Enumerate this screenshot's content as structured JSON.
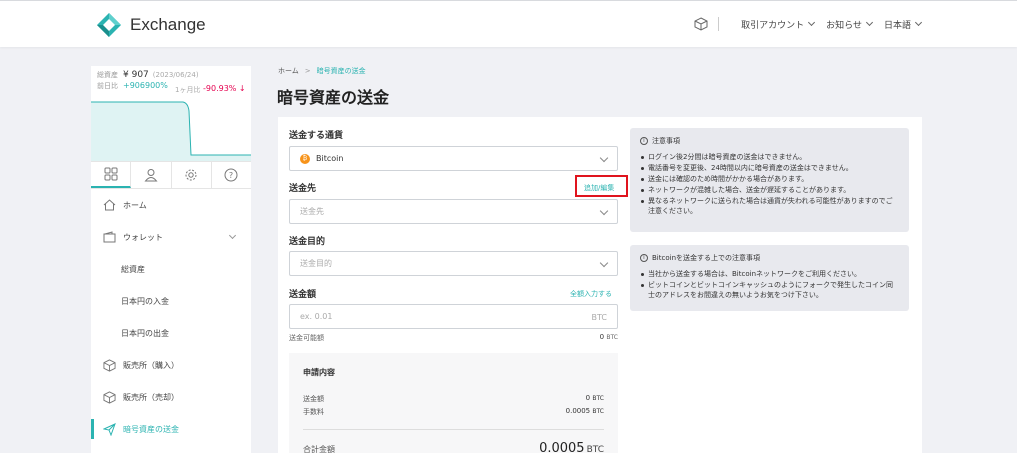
{
  "header": {
    "app_name": "Exchange",
    "nav": {
      "account": "取引アカウント",
      "news": "お知らせ",
      "language": "日本語"
    }
  },
  "sidebar": {
    "balance": {
      "total_label": "総資産",
      "total_value": "¥ 907",
      "date": "(2023/06/24)",
      "day_label": "前日比",
      "day_diff": "+906900%",
      "month_label": "1ヶ月比",
      "month_pct": "-90.93% ↓"
    },
    "tabs": [
      "grid-icon",
      "user-icon",
      "gear-icon",
      "help-icon"
    ],
    "menu": [
      {
        "label": "ホーム",
        "icon": "home-icon"
      },
      {
        "label": "ウォレット",
        "icon": "wallet-icon"
      },
      {
        "label": "総資産"
      },
      {
        "label": "日本円の入金"
      },
      {
        "label": "日本円の出金"
      },
      {
        "label": "販売所（購入）",
        "icon": "box-icon"
      },
      {
        "label": "販売所（売却）",
        "icon": "box-icon"
      },
      {
        "label": "暗号資産の送金",
        "icon": "send-icon"
      }
    ],
    "accent": "#2bb3b1"
  },
  "breadcrumb": {
    "home": "ホーム",
    "current": "暗号資産の送金"
  },
  "page_title": "暗号資産の送金",
  "form": {
    "currency_label": "送金する通貨",
    "currency_value": "Bitcoin",
    "dest_label": "送金先",
    "dest_link": "追加/編集",
    "dest_placeholder": "送金先",
    "purpose_label": "送金目的",
    "purpose_placeholder": "送金目的",
    "amount_label": "送金額",
    "amount_link": "全額入力する",
    "amount_placeholder": "ex. 0.01",
    "amount_unit": "BTC",
    "available_label": "送金可能額",
    "available_value": "0",
    "available_unit": "BTC"
  },
  "summary": {
    "title": "申請内容",
    "amount_label": "送金額",
    "amount_value": "0",
    "fee_label": "手数料",
    "fee_value": "0.0005",
    "total_label": "合計金額",
    "total_value": "0.0005",
    "unit": "BTC"
  },
  "notices": [
    {
      "title": "注意事項",
      "items": [
        "ログイン後2分間は暗号資産の送金はできません。",
        "電話番号を変更後、24時間以内に暗号資産の送金はできません。",
        "送金には確認のため時間がかかる場合があります。",
        "ネットワークが混雑した場合、送金が遅延することがあります。",
        "異なるネットワークに送られた場合は通貨が失われる可能性がありますのでご注意ください。"
      ]
    },
    {
      "title": "Bitcoinを送金する上での注意事項",
      "items": [
        "当社から送金する場合は、Bitcoinネットワークをご利用ください。",
        "ビットコインとビットコインキャッシュのようにフォークで発生したコイン同士のアドレスをお間違えの無いようお気をつけ下さい。"
      ]
    }
  ]
}
